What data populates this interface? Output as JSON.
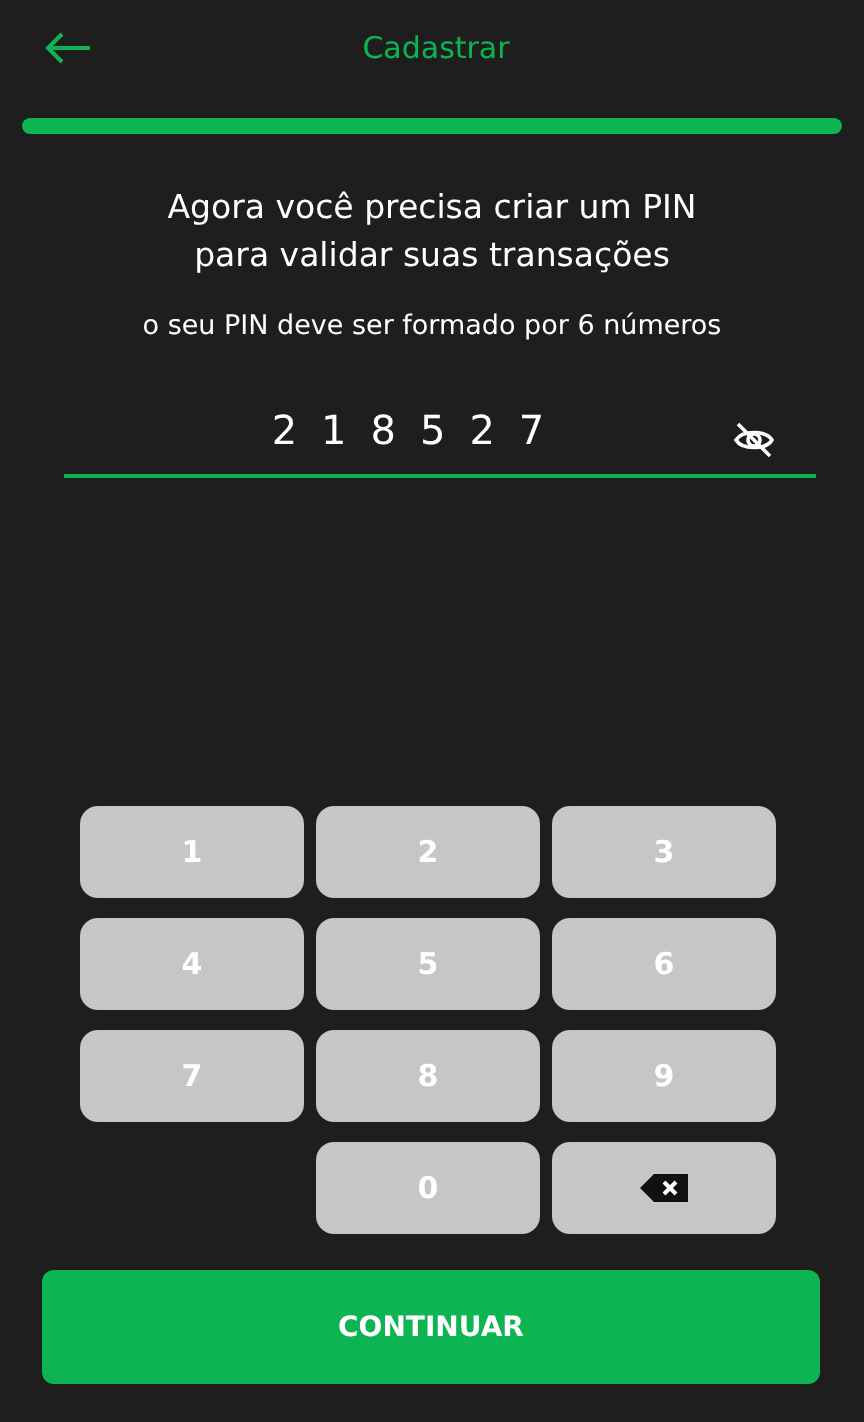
{
  "header": {
    "title": "Cadastrar"
  },
  "progress": {
    "level": 1
  },
  "heading": "Agora você precisa criar um PIN para validar suas transações",
  "hint": "o seu PIN deve ser formado por 6 números",
  "pin": {
    "value": "218527",
    "visible": true
  },
  "keypad": [
    {
      "kind": "digit",
      "label": "1"
    },
    {
      "kind": "digit",
      "label": "2"
    },
    {
      "kind": "digit",
      "label": "3"
    },
    {
      "kind": "digit",
      "label": "4"
    },
    {
      "kind": "digit",
      "label": "5"
    },
    {
      "kind": "digit",
      "label": "6"
    },
    {
      "kind": "digit",
      "label": "7"
    },
    {
      "kind": "digit",
      "label": "8"
    },
    {
      "kind": "digit",
      "label": "9"
    },
    {
      "kind": "empty"
    },
    {
      "kind": "digit",
      "label": "0"
    },
    {
      "kind": "backspace"
    }
  ],
  "primary_button": "CONTINUAR"
}
